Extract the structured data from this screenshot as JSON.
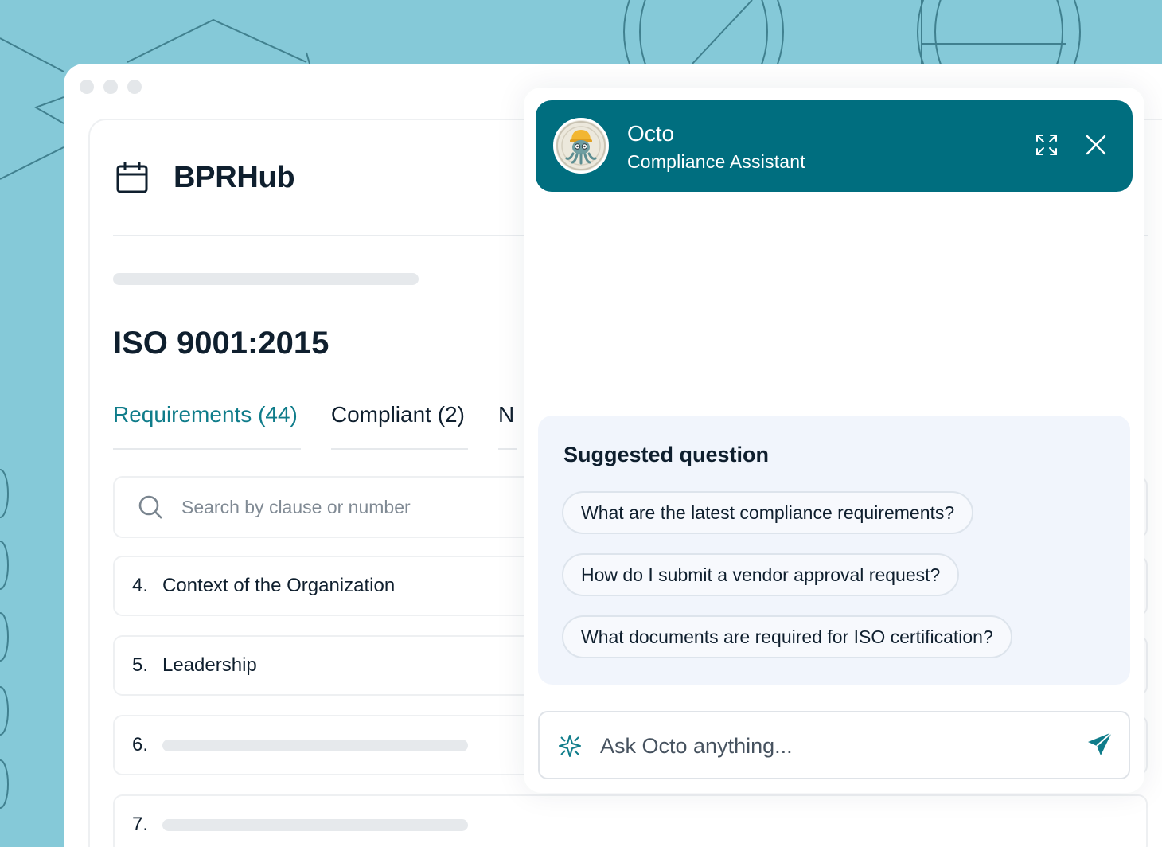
{
  "app": {
    "name": "BPRHub"
  },
  "document": {
    "title": "ISO 9001:2015"
  },
  "tabs": [
    {
      "label": "Requirements (44)"
    },
    {
      "label": "Compliant (2)"
    },
    {
      "label": "N"
    }
  ],
  "search": {
    "placeholder": "Search by clause or number"
  },
  "rows": [
    {
      "number": "4.",
      "label": "Context of the Organization"
    },
    {
      "number": "5.",
      "label": "Leadership"
    },
    {
      "number": "6.",
      "label": ""
    },
    {
      "number": "7.",
      "label": ""
    }
  ],
  "chat": {
    "name": "Octo",
    "subtitle": "Compliance Assistant",
    "suggested_title": "Suggested question",
    "suggestions": [
      "What are the latest compliance requirements?",
      "How do I submit a vendor approval request?",
      "What documents are required for ISO certification?"
    ],
    "input_placeholder": "Ask Octo anything..."
  },
  "colors": {
    "background": "#85c9d8",
    "accent": "#006e7f",
    "active_tab": "#0f7c8a",
    "suggest_bg": "#f1f5fc"
  },
  "icons": {
    "brand": "calendar-icon",
    "search": "search-icon",
    "expand": "expand-icon",
    "close": "close-icon",
    "sparkle": "sparkle-icon",
    "send": "send-icon"
  }
}
